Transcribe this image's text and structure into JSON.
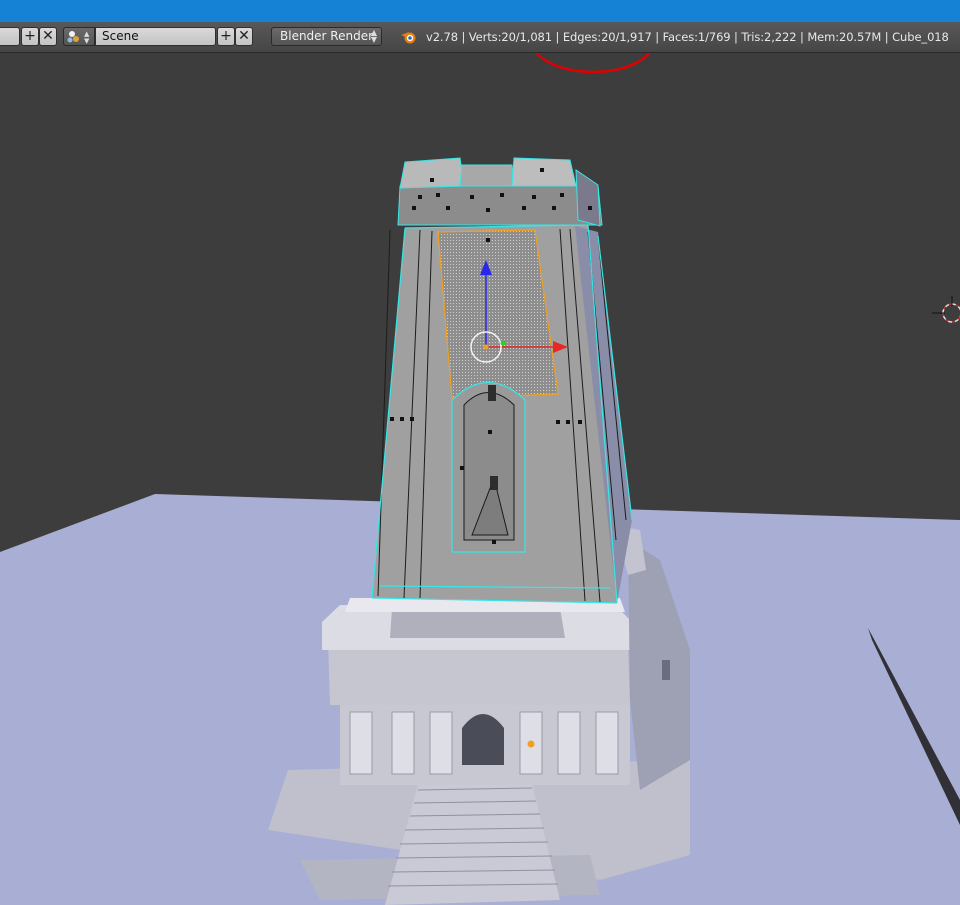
{
  "header": {
    "scene_field": {
      "value": "Scene"
    },
    "render_engine": {
      "selected": "Blender Render"
    },
    "stats_text": "v2.78 | Verts:20/1,081 | Edges:20/1,917 | Faces:1/769 | Tris:2,222 | Mem:20.57M | Cube_018"
  },
  "icons": {
    "add": "plus-icon",
    "close": "close-icon",
    "scene_type": "scene-icon",
    "blender": "blender-logo-icon"
  },
  "colors": {
    "top_strip": "#1682d6",
    "header_bg": "#4f4f4f",
    "viewport_bg": "#3d3d3d",
    "ground_plane": "#a9aed4",
    "selection_outline": "#37e6e6",
    "active_face": "#f0a020",
    "annotation_circle": "#e00000"
  }
}
